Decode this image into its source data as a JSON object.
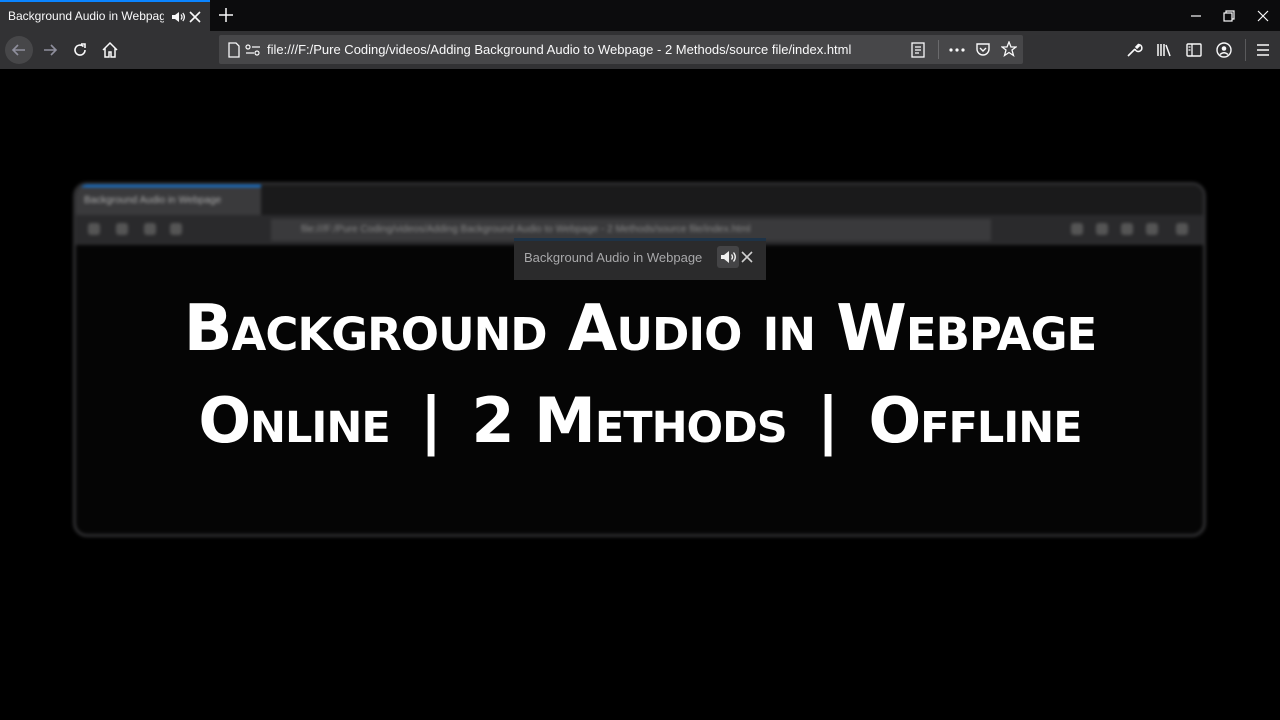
{
  "browser": {
    "tab": {
      "title": "Background Audio in Webpage",
      "audio_icon": "speaker-icon",
      "close_icon": "close-icon"
    },
    "new_tab_icon": "plus-icon",
    "window_controls": [
      "minimize-icon",
      "restore-icon",
      "close-icon"
    ],
    "nav": [
      "back-arrow-icon",
      "forward-arrow-icon",
      "reload-icon",
      "home-icon"
    ],
    "url": "file:///F:/Pure Coding/videos/Adding Background Audio to Webpage - 2 Methods/source file/index.html",
    "url_icons": [
      "page-icon",
      "permissions-icon",
      "reader-view-icon",
      "more-icon",
      "pocket-icon",
      "bookmark-star-icon"
    ],
    "tools": [
      "wrench-icon",
      "library-icon",
      "sidebar-icon",
      "account-icon",
      "menu-icon"
    ]
  },
  "content": {
    "blurred_browser": {
      "tab_title": "Background Audio in Webpage",
      "url": "file:///F:/Pure Coding/videos/Adding Background Audio to Webpage - 2 Methods/source file/index.html"
    },
    "tooltip": {
      "title": "Background Audio in Webpage",
      "audio_icon": "speaker-icon",
      "close_icon": "close-icon"
    },
    "headline_line1": "Background Audio in Webpage",
    "headline_line2": {
      "left": "Online",
      "middle": "2 Methods",
      "right": "Offline",
      "separator": "|"
    }
  },
  "colors": {
    "accent": "#0a84ff",
    "tabbar": "#0c0c0d",
    "toolbar": "#323234",
    "urlbar": "#474749"
  }
}
